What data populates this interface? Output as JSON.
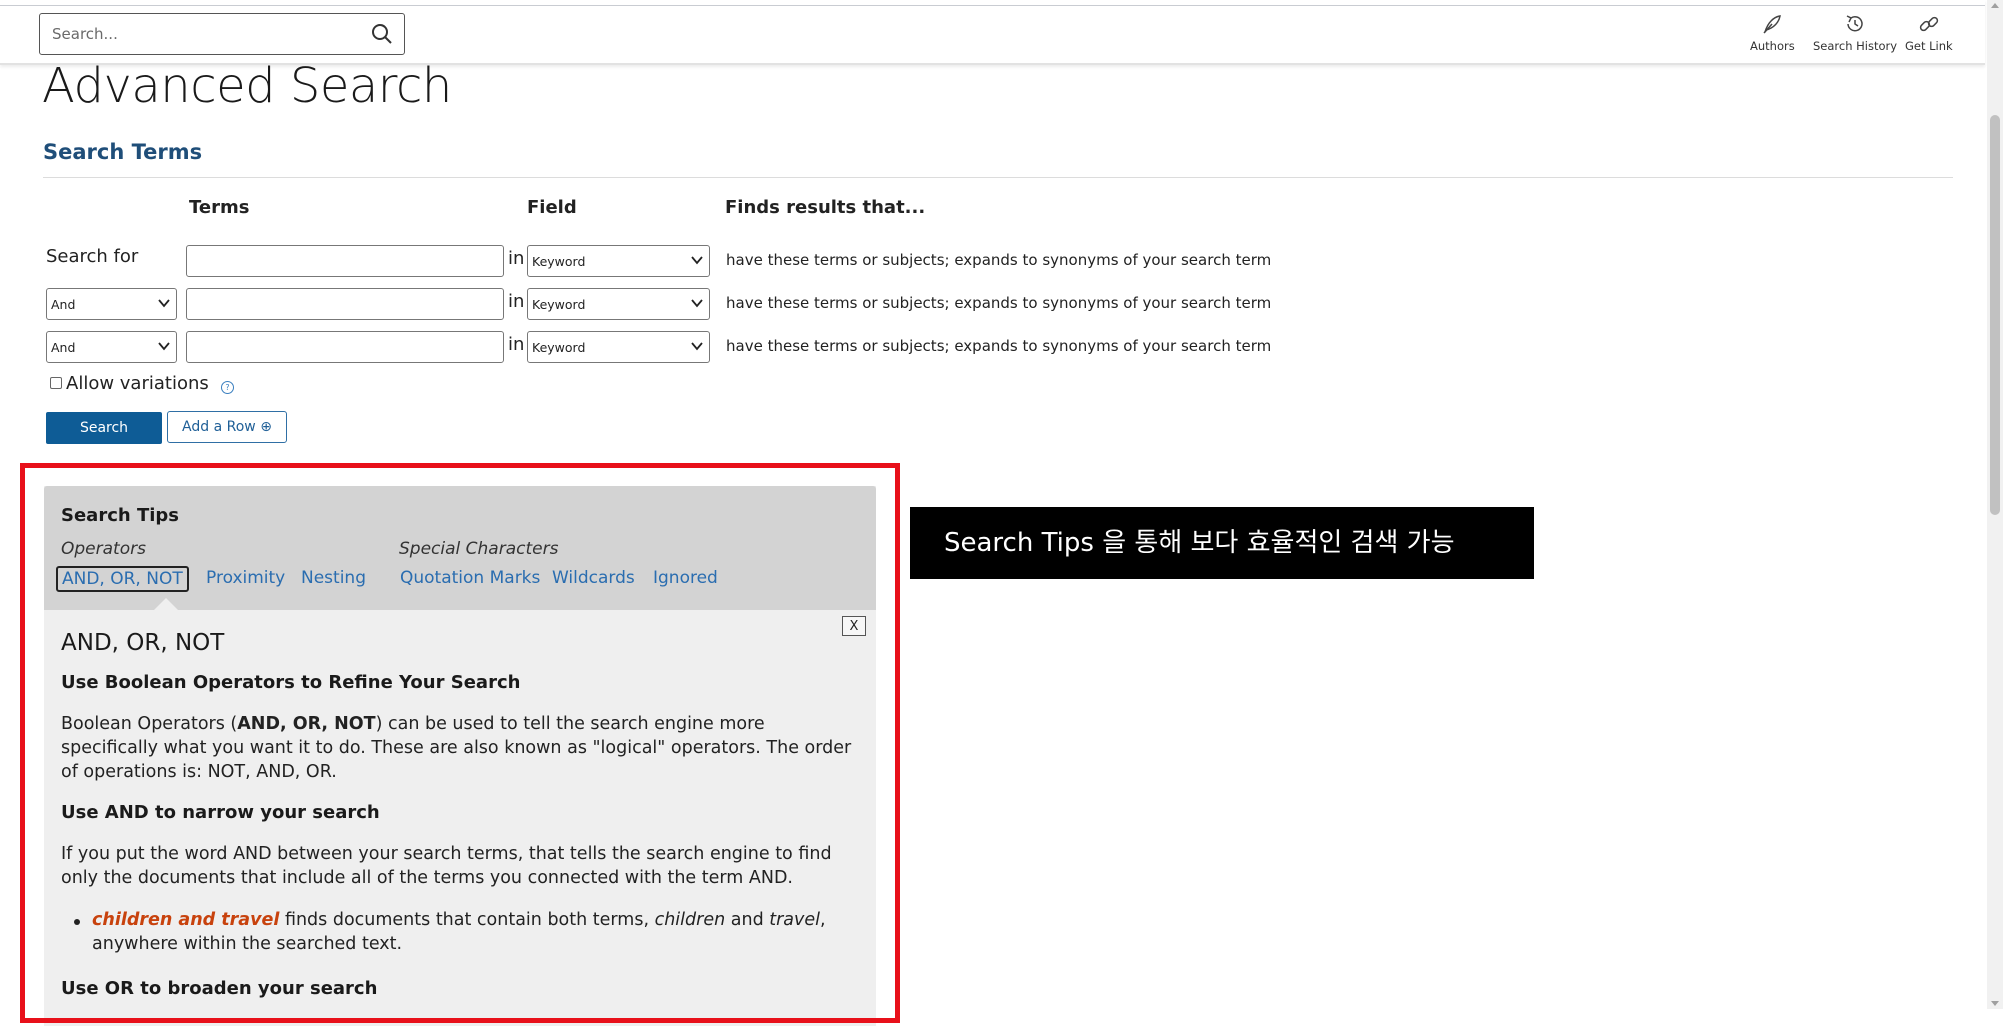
{
  "topbar": {
    "search_placeholder": "Search...",
    "tools": [
      {
        "label": "Authors",
        "icon": "quill-icon"
      },
      {
        "label": "Search History",
        "icon": "history-icon"
      },
      {
        "label": "Get Link",
        "icon": "link-icon"
      }
    ]
  },
  "page": {
    "title": "Advanced Search",
    "section_title": "Search Terms"
  },
  "form": {
    "columns": {
      "terms": "Terms",
      "field": "Field",
      "finds": "Finds results that..."
    },
    "rows": [
      {
        "label": "Search for",
        "operator": null,
        "term": "",
        "in": "in",
        "field": "Keyword",
        "description": "have these terms or subjects; expands to synonyms of your search term"
      },
      {
        "label": null,
        "operator": "And",
        "term": "",
        "in": "in",
        "field": "Keyword",
        "description": "have these terms or subjects; expands to synonyms of your search term"
      },
      {
        "label": null,
        "operator": "And",
        "term": "",
        "in": "in",
        "field": "Keyword",
        "description": "have these terms or subjects; expands to synonyms of your search term"
      }
    ],
    "allow_variations": {
      "label": "Allow variations",
      "checked": false,
      "help": "?"
    },
    "search_button": "Search",
    "add_row_button": "Add a Row ⊕"
  },
  "tips": {
    "title": "Search Tips",
    "categories": {
      "operators": "Operators",
      "special": "Special Characters"
    },
    "links": [
      "AND, OR, NOT",
      "Proximity",
      "Nesting",
      "Quotation Marks",
      "Wildcards",
      "Ignored"
    ],
    "active_link": "AND, OR, NOT",
    "close_label": "X",
    "content": {
      "heading": "AND, OR, NOT",
      "sub1": "Use Boolean Operators to Refine Your Search",
      "p1_pre": "Boolean Operators (",
      "p1_bold": "AND, OR, NOT",
      "p1_post": ") can be used to tell the search engine more specifically what you want it to do. These are also known as \"logical\" operators. The order of operations is: NOT, AND, OR.",
      "sub2": "Use AND to narrow your search",
      "p2": "If you put the word AND between your search terms, that tells the search engine to find only the documents that include all of the terms you connected with the term AND.",
      "bullet_example": "children and travel",
      "bullet_mid": " finds documents that contain both terms, ",
      "bullet_t1": "children",
      "bullet_and": " and ",
      "bullet_t2": "travel",
      "bullet_end": ", anywhere within the searched text.",
      "sub3": "Use OR to broaden your search"
    }
  },
  "annotation": {
    "callout_text": "Search Tips 을 통해 보다 효율적인 검색 가능"
  },
  "colors": {
    "brand_blue": "#0e5c96",
    "link_blue": "#2a6db0",
    "highlight_red": "#e8101a",
    "example_orange": "#c8420d"
  }
}
